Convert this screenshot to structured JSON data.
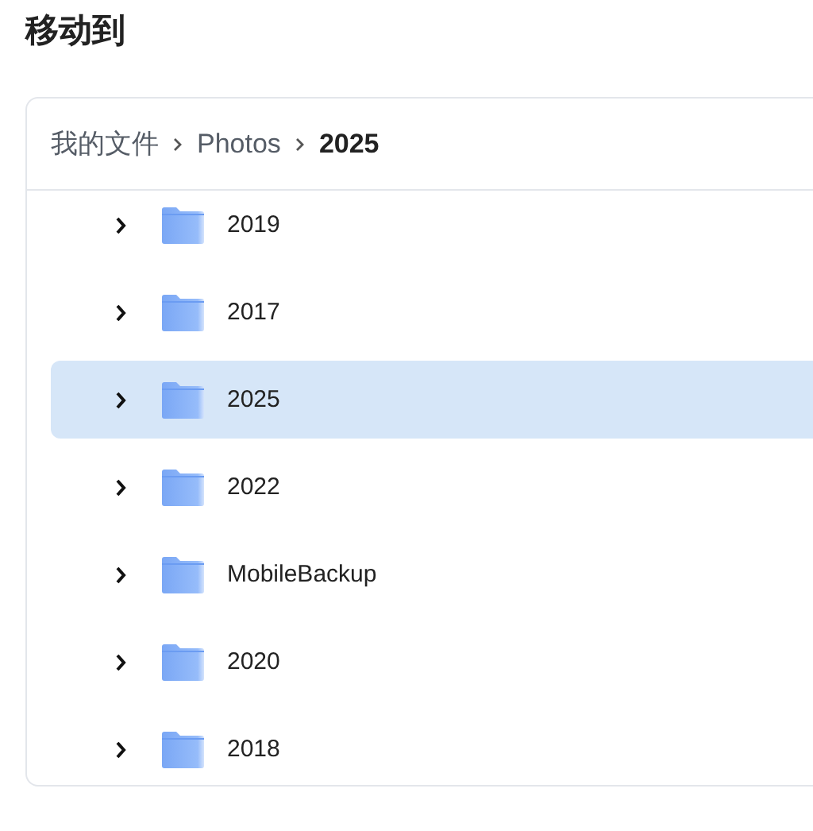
{
  "title": "移动到",
  "breadcrumb": [
    {
      "label": "我的文件",
      "current": false
    },
    {
      "label": "Photos",
      "current": false
    },
    {
      "label": "2025",
      "current": true
    }
  ],
  "folders": [
    {
      "name": "2019",
      "selected": false
    },
    {
      "name": "2017",
      "selected": false
    },
    {
      "name": "2025",
      "selected": true
    },
    {
      "name": "2022",
      "selected": false
    },
    {
      "name": "MobileBackup",
      "selected": false
    },
    {
      "name": "2020",
      "selected": false
    },
    {
      "name": "2018",
      "selected": false
    }
  ]
}
